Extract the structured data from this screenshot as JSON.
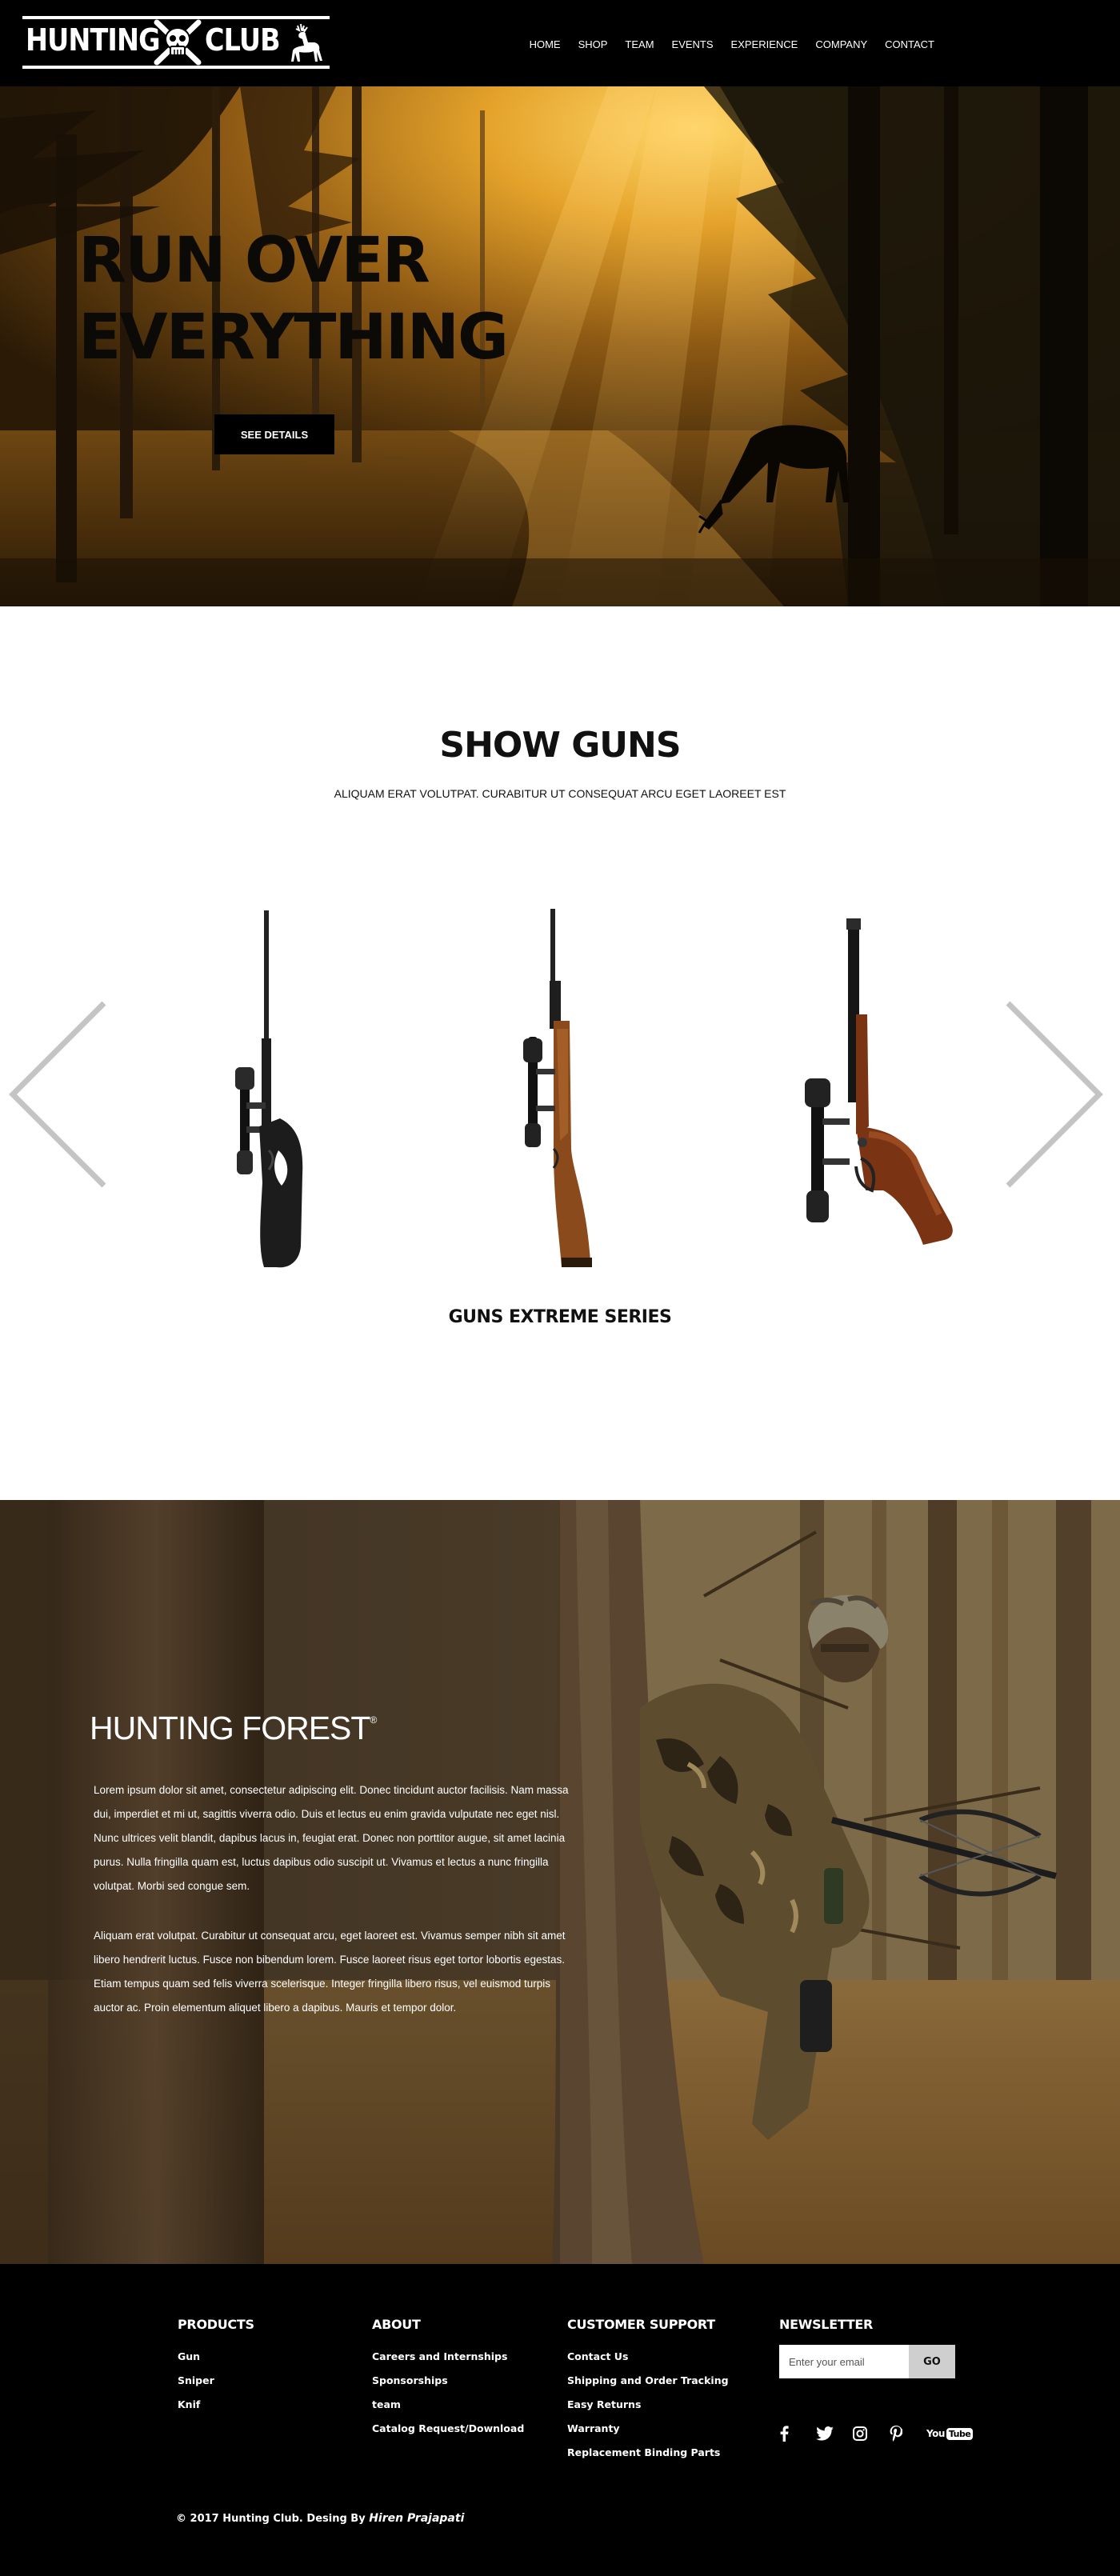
{
  "header": {
    "logo": {
      "word1": "HUNTING",
      "word2": "CLUB"
    },
    "nav": [
      "HOME",
      "SHOP",
      "TEAM",
      "EVENTS",
      "EXPERIENCE",
      "COMPANY",
      "CONTACT"
    ]
  },
  "hero": {
    "title_line1": "RUN OVER",
    "title_line2": "EVERYTHING",
    "button_label": "SEE DETAILS"
  },
  "guns": {
    "title": "SHOW GUNS",
    "subtitle": "ALIQUAM ERAT VOLUTPAT. CURABITUR UT CONSEQUAT ARCU EGET LAOREET EST",
    "series_label": "GUNS EXTREME SERIES",
    "items": [
      {
        "icon": "black-scoped-rifle-icon",
        "stock_color": "#1c1c1c"
      },
      {
        "icon": "wood-scoped-rifle-icon",
        "stock_color": "#8a4a1c"
      },
      {
        "icon": "scoped-pistol-icon",
        "stock_color": "#7a3414"
      }
    ],
    "arrow_color": "#c4c4c4"
  },
  "forest": {
    "title": "HUNTING FOREST",
    "trademark": "®",
    "paragraph1": "Lorem ipsum dolor sit amet, consectetur adipiscing elit. Donec tincidunt auctor facilisis. Nam massa dui, imperdiet et mi ut, sagittis viverra odio. Duis et lectus eu enim gravida vulputate nec eget nisl. Nunc ultrices velit blandit, dapibus lacus in, feugiat erat. Donec non porttitor augue, sit amet lacinia purus. Nulla fringilla quam est, luctus dapibus odio suscipit ut. Vivamus et lectus a nunc fringilla volutpat. Morbi sed congue sem.",
    "paragraph2": "Aliquam erat volutpat. Curabitur ut consequat arcu, eget laoreet est. Vivamus semper nibh sit amet libero hendrerit luctus. Fusce non bibendum lorem. Fusce laoreet risus eget tortor lobortis egestas. Etiam tempus quam sed felis viverra scelerisque. Integer fringilla libero risus, vel euismod turpis auctor ac. Proin elementum aliquet libero a dapibus. Mauris et tempor dolor."
  },
  "footer": {
    "products": {
      "heading": "PRODUCTS",
      "links": [
        "Gun",
        "Sniper",
        "Knif"
      ]
    },
    "about": {
      "heading": "ABOUT",
      "links": [
        "Careers and Internships",
        "Sponsorships",
        "team",
        "Catalog Request/Download"
      ]
    },
    "support": {
      "heading": "CUSTOMER SUPPORT",
      "links": [
        "Contact Us",
        "Shipping and Order Tracking",
        "Easy Returns",
        "Warranty",
        "Replacement Binding Parts"
      ]
    },
    "newsletter": {
      "heading": "NEWSLETTER",
      "placeholder": "Enter your email",
      "button": "GO"
    },
    "social": [
      "facebook-icon",
      "twitter-icon",
      "instagram-icon",
      "pinterest-icon",
      "youtube-icon"
    ],
    "youtube_text_you": "You",
    "youtube_text_tube": "Tube",
    "copyright_prefix": "© 2017 Hunting Club. Desing By",
    "copyright_author": "Hiren Prajapati"
  }
}
